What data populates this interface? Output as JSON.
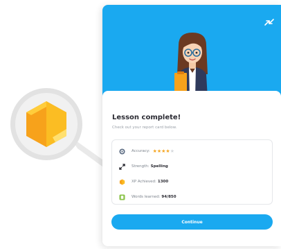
{
  "lesson": {
    "title": "Lesson complete!",
    "subtitle": "Check out your report card below."
  },
  "stats": {
    "accuracy": {
      "label": "Accuracy:",
      "rating": 4,
      "max_rating": 5,
      "stars_on": "★★★★",
      "stars_off": "★"
    },
    "strength": {
      "label": "Strength:",
      "value": "Spelling"
    },
    "xp": {
      "label": "XP Achieved:",
      "value": "1300"
    },
    "words": {
      "label": "Words learned:",
      "value": "94/850"
    }
  },
  "actions": {
    "continue_label": "Continue"
  },
  "icons": {
    "swap": "swap-arrows-icon",
    "accuracy": "target-icon",
    "strength": "expand-arrows-icon",
    "xp": "hexagon-xp-icon",
    "words": "book-icon"
  },
  "colors": {
    "primary_blue": "#1aa9f0",
    "xp_orange": "#f7a21b",
    "star_gold": "#f5a623",
    "words_green": "#8bc34a",
    "text_dark": "#2b2b33",
    "text_muted": "#9aa0a8"
  }
}
